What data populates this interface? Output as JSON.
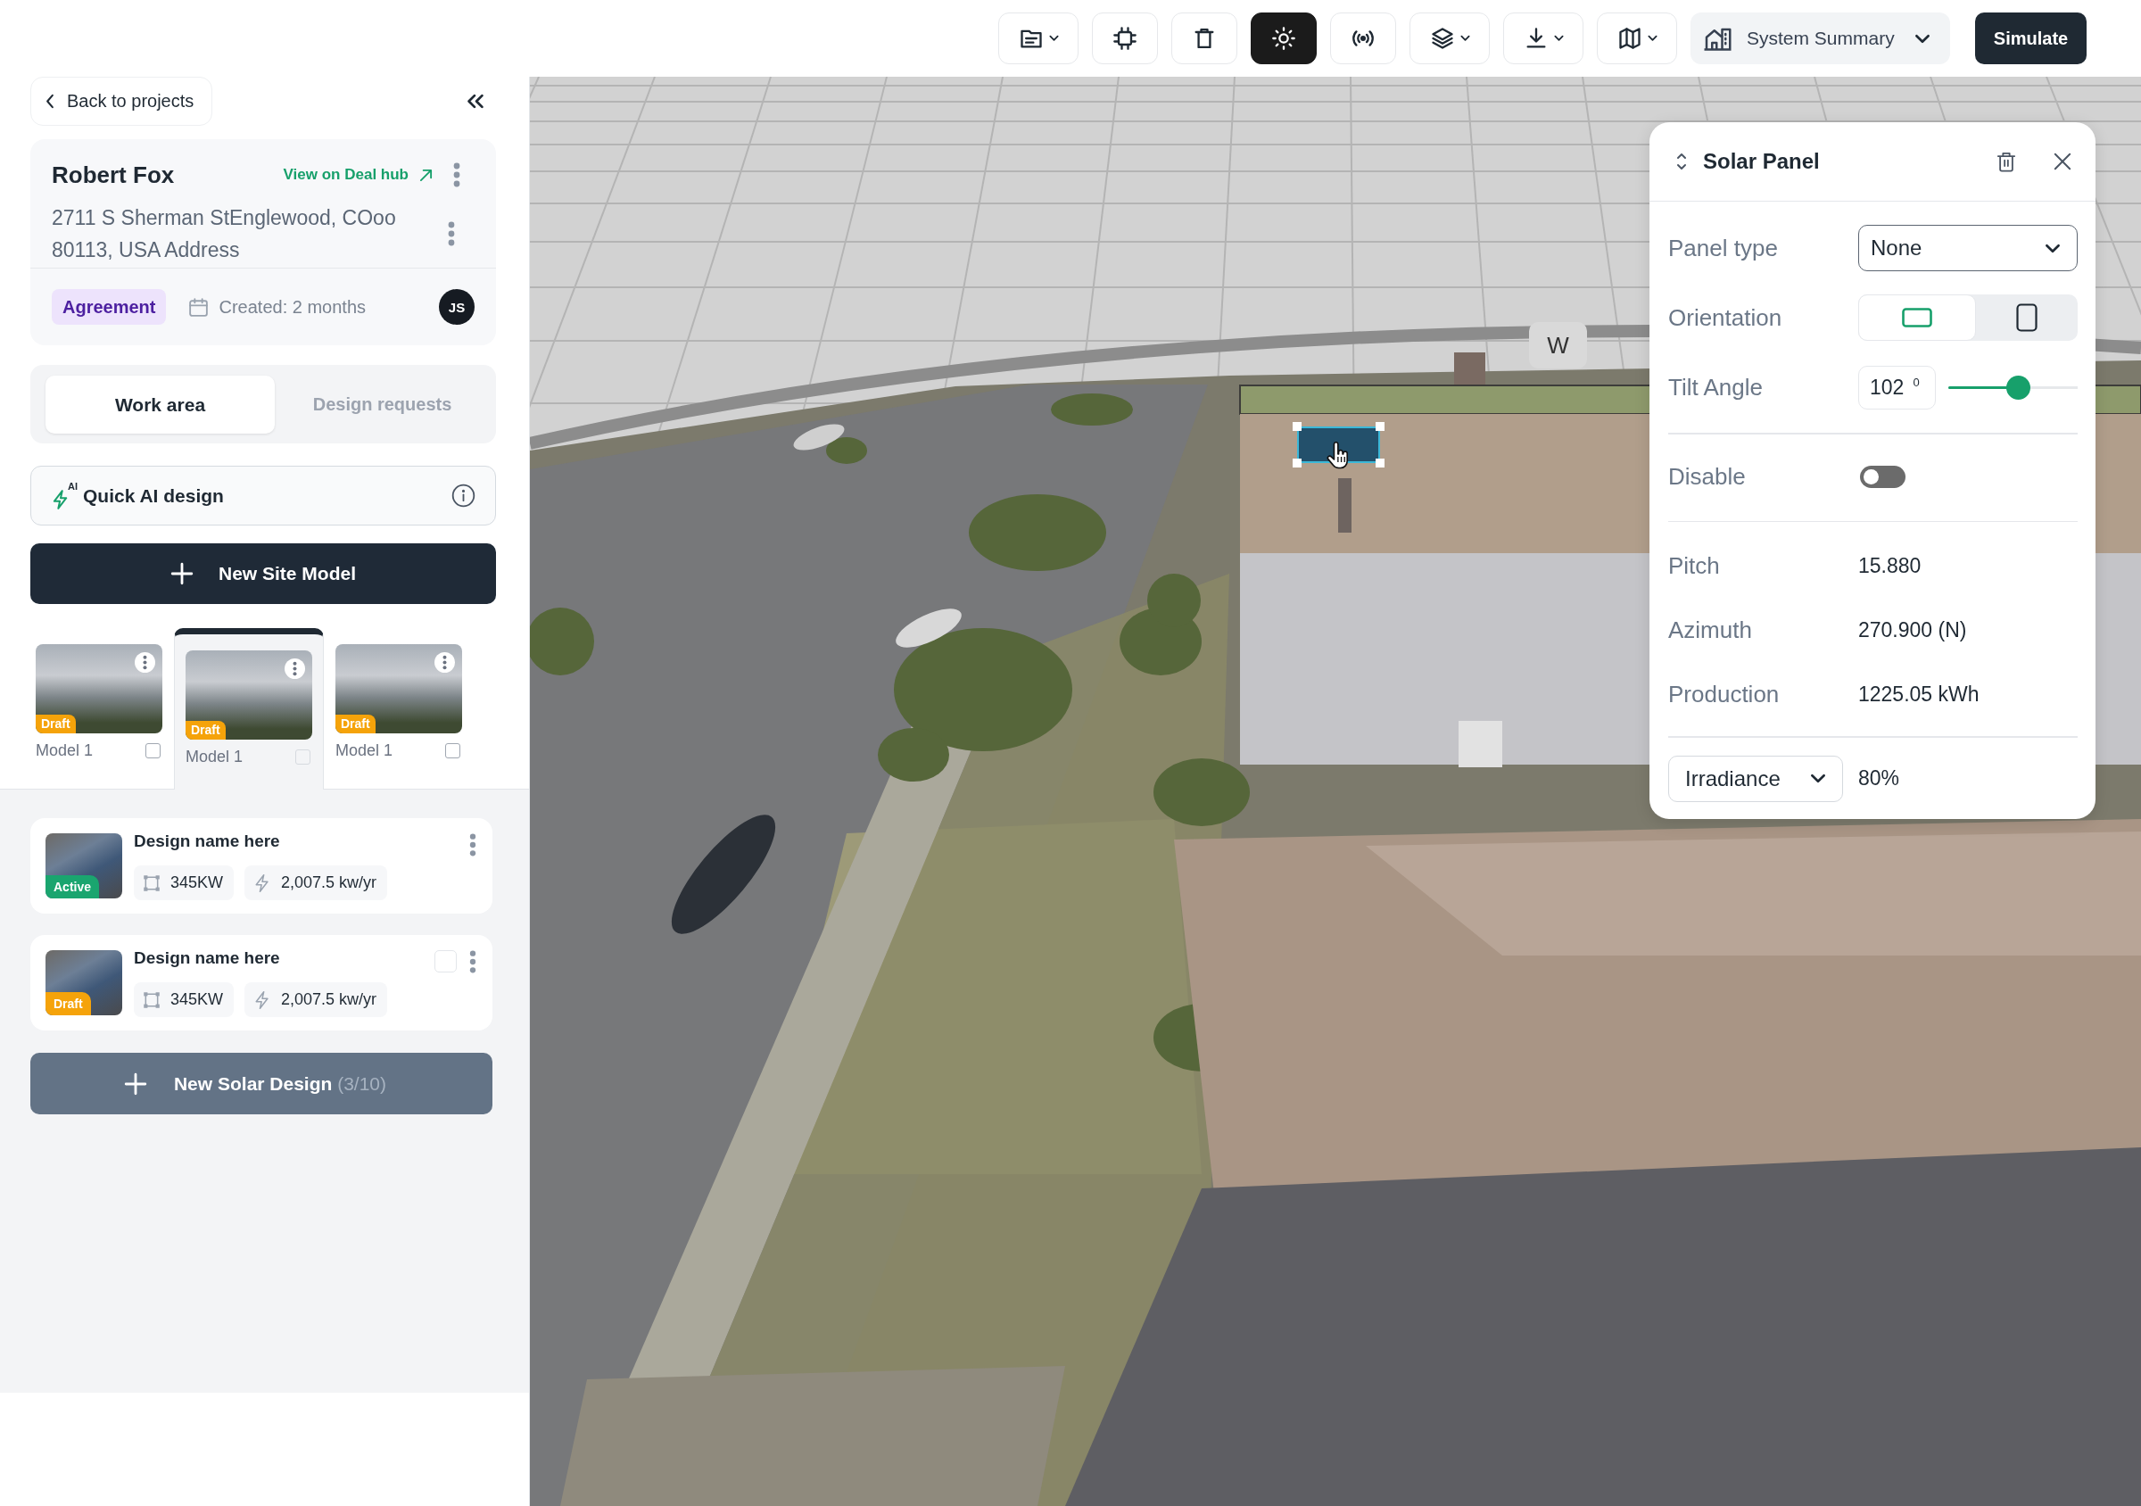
{
  "toolbar": {
    "tools": [
      {
        "caret": true,
        "selected": false
      },
      {
        "caret": false,
        "selected": false
      },
      {
        "caret": false,
        "selected": false
      },
      {
        "caret": false,
        "selected": true
      },
      {
        "caret": false,
        "selected": false
      },
      {
        "caret": true,
        "selected": false
      },
      {
        "caret": true,
        "selected": false
      },
      {
        "caret": true,
        "selected": false
      }
    ],
    "summary": {
      "label": "System Summary"
    },
    "simulate": {
      "label": "Simulate"
    }
  },
  "sidebar": {
    "back_button": {
      "label": "Back to projects"
    },
    "customer": {
      "name": "Robert Fox",
      "link": "View on Deal hub",
      "address": "2711 S Sherman StEnglewood, COoo 80113, USA Address",
      "stage": "Agreement",
      "created": "Created: 2 months",
      "owner_initials": "JS"
    },
    "tabs": [
      {
        "label": "Work area",
        "selected": true
      },
      {
        "label": "Design requests",
        "selected": false
      }
    ],
    "quick_ai": {
      "label": "Quick AI design",
      "badge": "AI"
    },
    "new_site_model": {
      "label": "New Site Model"
    },
    "models": [
      {
        "name": "Model 1",
        "status": "Draft",
        "selected": false,
        "checked": false
      },
      {
        "name": "Model 1",
        "status": "Draft",
        "selected": true,
        "checked": false
      },
      {
        "name": "Model 1",
        "status": "Draft",
        "selected": false,
        "checked": false
      }
    ],
    "designs": [
      {
        "name": "Design name here",
        "status": "Active",
        "color": "#1aa56f",
        "capacity": "345KW",
        "production": "2,007.5 kw/yr"
      },
      {
        "name": "Design name here",
        "status": "Draft",
        "color": "#f5a30a",
        "capacity": "345KW",
        "production": "2,007.5 kw/yr",
        "checkbox": {
          "checked": false
        }
      }
    ],
    "new_solar_design": {
      "label": "New Solar Design",
      "count": "(3/10)"
    }
  },
  "map": {
    "compass_label": "W"
  },
  "inspector": {
    "title": "Solar Panel",
    "panel_type": {
      "label": "Panel type",
      "value": "None"
    },
    "orientation": {
      "label": "Orientation",
      "options": [
        {
          "selected": true
        },
        {
          "selected": false
        }
      ]
    },
    "tilt": {
      "label": "Tilt Angle",
      "value": "102",
      "unit": "0",
      "level": 0.54
    },
    "disable": {
      "label": "Disable",
      "on": false
    },
    "stats": [
      {
        "label": "Pitch",
        "value": "15.880"
      },
      {
        "label": "Azimuth",
        "value": "270.900 (N)"
      },
      {
        "label": "Production",
        "value": "1225.05 kWh"
      }
    ],
    "overlay": {
      "value": "Irradiance",
      "reading": "80%"
    }
  }
}
